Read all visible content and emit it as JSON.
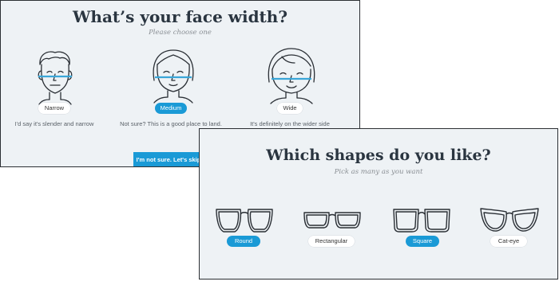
{
  "face_width": {
    "title": "What’s your face width?",
    "subtitle": "Please choose one",
    "options": [
      {
        "label": "Narrow",
        "caption": "I'd say it's slender and narrow",
        "selected": false
      },
      {
        "label": "Medium",
        "caption": "Not sure? This is a good place to land.",
        "selected": true
      },
      {
        "label": "Wide",
        "caption": "It's definitely on the wider side",
        "selected": false
      }
    ],
    "skip_label": "I'm not sure. Let's skip it."
  },
  "shapes": {
    "title": "Which shapes do you like?",
    "subtitle": "Pick as many as you want",
    "options": [
      {
        "label": "Round",
        "icon": "round-glasses-icon",
        "selected": true
      },
      {
        "label": "Rectangular",
        "icon": "rectangular-glasses-icon",
        "selected": false
      },
      {
        "label": "Square",
        "icon": "square-glasses-icon",
        "selected": true
      },
      {
        "label": "Cat-eye",
        "icon": "cat-eye-glasses-icon",
        "selected": false
      }
    ]
  },
  "colors": {
    "accent": "#1a9ad6",
    "panel_bg": "#eef2f5",
    "title_text": "#2a3540",
    "measure_line": "#3aa6d8"
  }
}
